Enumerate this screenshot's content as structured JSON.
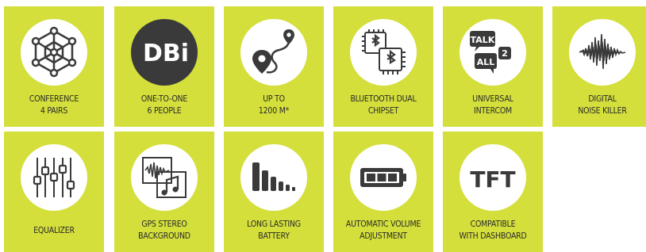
{
  "features": [
    {
      "icon": "conference-network-icon",
      "line1": "CONFERENCE",
      "line2": "4 PAIRS"
    },
    {
      "icon": "dbi-logo-icon",
      "line1": "ONE-TO-ONE",
      "line2": "6 PEOPLE",
      "icon_text": "DBi"
    },
    {
      "icon": "gps-route-icon",
      "line1": "UP TO",
      "line2": "1200 M*"
    },
    {
      "icon": "bluetooth-chipset-icon",
      "line1": "BLUETOOTH DUAL",
      "line2": "CHIPSET"
    },
    {
      "icon": "talk-all-bubbles-icon",
      "line1": "UNIVERSAL",
      "line2": "INTERCOM",
      "icon_text_1": "TALK",
      "icon_text_2": "ALL",
      "icon_text_3": "2"
    },
    {
      "icon": "noise-waveform-icon",
      "line1": "DIGITAL",
      "line2": "NOISE KILLER"
    },
    {
      "icon": "equalizer-sliders-icon",
      "line1": "EQUALIZER",
      "line2": ""
    },
    {
      "icon": "stereo-background-icon",
      "line1": "GPS STEREO",
      "line2": "BACKGROUND"
    },
    {
      "icon": "battery-bars-icon",
      "line1": "LONG LASTING",
      "line2": "BATTERY"
    },
    {
      "icon": "volume-meter-icon",
      "line1": "AUTOMATIC VOLUME",
      "line2": "ADJUSTMENT"
    },
    {
      "icon": "tft-display-icon",
      "line1": "COMPATIBLE",
      "line2": "WITH DASHBOARD",
      "icon_text": "TFT"
    }
  ],
  "colors": {
    "tile": "#d4df3b",
    "icon": "#3a3a3a",
    "text": "#2b2b2b"
  }
}
